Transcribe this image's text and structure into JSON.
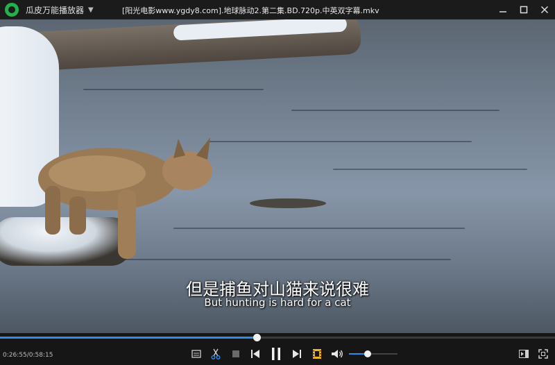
{
  "titlebar": {
    "app_name": "瓜皮万能播放器",
    "menu_caret": "▼",
    "file_title": "[阳光电影www.ygdy8.com].地球脉动2.第二集.BD.720p.中英双字幕.mkv"
  },
  "subtitles": {
    "chinese": "但是捕鱼对山猫来说很难",
    "english": "But hunting is hard for a cat"
  },
  "playback": {
    "time_display": "0:26:55/0:58:15",
    "progress_fraction": 0.462,
    "volume_fraction": 0.38,
    "state": "playing"
  },
  "icons": {
    "logo": "app-logo-icon",
    "minimize": "minimize-icon",
    "maximize": "maximize-icon",
    "close": "close-icon",
    "screenshot": "image-icon",
    "clip": "scissors-icon",
    "stop": "stop-icon",
    "prev": "skip-previous-icon",
    "pause": "pause-icon",
    "next": "skip-next-icon",
    "playlist": "film-icon",
    "volume": "volume-icon",
    "sidebar": "sidebar-toggle-icon",
    "fullscreen": "fullscreen-icon"
  },
  "colors": {
    "accent": "#2a8ef0",
    "logo": "#22b14c",
    "film_icon": "#f0b429"
  }
}
